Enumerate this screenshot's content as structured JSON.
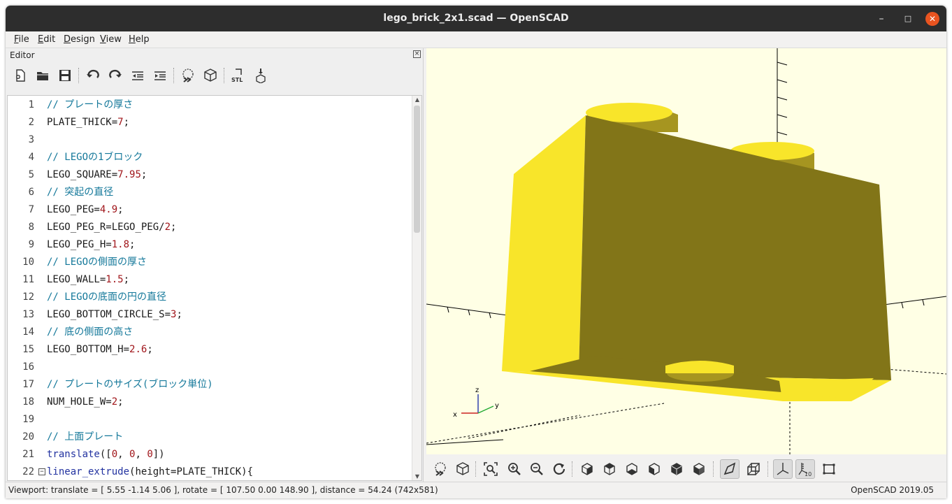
{
  "window": {
    "title": "lego_brick_2x1.scad — OpenSCAD",
    "controls": {
      "minimize": "–",
      "maximize": "□",
      "close": "✕"
    }
  },
  "menubar": [
    {
      "key": "F",
      "rest": "ile"
    },
    {
      "key": "E",
      "rest": "dit"
    },
    {
      "key": "D",
      "rest": "esign"
    },
    {
      "key": "V",
      "rest": "iew"
    },
    {
      "key": "H",
      "rest": "elp"
    }
  ],
  "editor": {
    "title": "Editor",
    "toolbar_icons": [
      "new-file-icon",
      "open-file-icon",
      "save-icon",
      "undo-icon",
      "redo-icon",
      "unindent-icon",
      "indent-icon",
      "preview-icon",
      "render-icon",
      "export-stl-icon",
      "send-to-3d-print-icon"
    ],
    "lines": [
      {
        "n": "1",
        "t": [
          {
            "c": "comment",
            "s": "// プレートの厚さ"
          }
        ]
      },
      {
        "n": "2",
        "t": [
          {
            "c": "ident",
            "s": "PLATE_THICK="
          },
          {
            "c": "num",
            "s": "7"
          },
          {
            "c": "ident",
            "s": ";"
          }
        ]
      },
      {
        "n": "3",
        "t": []
      },
      {
        "n": "4",
        "t": [
          {
            "c": "comment",
            "s": "// LEGOの1ブロック"
          }
        ]
      },
      {
        "n": "5",
        "t": [
          {
            "c": "ident",
            "s": "LEGO_SQUARE="
          },
          {
            "c": "num",
            "s": "7.95"
          },
          {
            "c": "ident",
            "s": ";"
          }
        ]
      },
      {
        "n": "6",
        "t": [
          {
            "c": "comment",
            "s": "// 突起の直径"
          }
        ]
      },
      {
        "n": "7",
        "t": [
          {
            "c": "ident",
            "s": "LEGO_PEG="
          },
          {
            "c": "num",
            "s": "4.9"
          },
          {
            "c": "ident",
            "s": ";"
          }
        ]
      },
      {
        "n": "8",
        "t": [
          {
            "c": "ident",
            "s": "LEGO_PEG_R=LEGO_PEG/"
          },
          {
            "c": "num",
            "s": "2"
          },
          {
            "c": "ident",
            "s": ";"
          }
        ]
      },
      {
        "n": "9",
        "t": [
          {
            "c": "ident",
            "s": "LEGO_PEG_H="
          },
          {
            "c": "num",
            "s": "1.8"
          },
          {
            "c": "ident",
            "s": ";"
          }
        ]
      },
      {
        "n": "10",
        "t": [
          {
            "c": "comment",
            "s": "// LEGOの側面の厚さ"
          }
        ]
      },
      {
        "n": "11",
        "t": [
          {
            "c": "ident",
            "s": "LEGO_WALL="
          },
          {
            "c": "num",
            "s": "1.5"
          },
          {
            "c": "ident",
            "s": ";"
          }
        ]
      },
      {
        "n": "12",
        "t": [
          {
            "c": "comment",
            "s": "// LEGOの底面の円の直径"
          }
        ]
      },
      {
        "n": "13",
        "t": [
          {
            "c": "ident",
            "s": "LEGO_BOTTOM_CIRCLE_S="
          },
          {
            "c": "num",
            "s": "3"
          },
          {
            "c": "ident",
            "s": ";"
          }
        ]
      },
      {
        "n": "14",
        "t": [
          {
            "c": "comment",
            "s": "// 底の側面の高さ"
          }
        ]
      },
      {
        "n": "15",
        "t": [
          {
            "c": "ident",
            "s": "LEGO_BOTTOM_H="
          },
          {
            "c": "num",
            "s": "2.6"
          },
          {
            "c": "ident",
            "s": ";"
          }
        ]
      },
      {
        "n": "16",
        "t": []
      },
      {
        "n": "17",
        "t": [
          {
            "c": "comment",
            "s": "// プレートのサイズ(ブロック単位)"
          }
        ]
      },
      {
        "n": "18",
        "t": [
          {
            "c": "ident",
            "s": "NUM_HOLE_W="
          },
          {
            "c": "num",
            "s": "2"
          },
          {
            "c": "ident",
            "s": ";"
          }
        ]
      },
      {
        "n": "19",
        "t": []
      },
      {
        "n": "20",
        "t": [
          {
            "c": "comment",
            "s": "// 上面プレート"
          }
        ]
      },
      {
        "n": "21",
        "t": [
          {
            "c": "kw",
            "s": "translate"
          },
          {
            "c": "ident",
            "s": "(["
          },
          {
            "c": "num",
            "s": "0"
          },
          {
            "c": "ident",
            "s": ", "
          },
          {
            "c": "num",
            "s": "0"
          },
          {
            "c": "ident",
            "s": ", "
          },
          {
            "c": "num",
            "s": "0"
          },
          {
            "c": "ident",
            "s": "])"
          }
        ]
      },
      {
        "n": "22",
        "fold": "−",
        "t": [
          {
            "c": "kw",
            "s": "linear_extrude"
          },
          {
            "c": "ident",
            "s": "(height=PLATE_THICK){"
          }
        ]
      }
    ]
  },
  "viewport": {
    "colors": {
      "background": "#ffffe5",
      "face_light": "#f8e52a",
      "face_dark": "#827518",
      "face_mid": "#a69520"
    },
    "axis_labels": {
      "z": "z",
      "x": "x",
      "y": "y"
    },
    "toolbar_icons": [
      "preview-icon",
      "render-icon",
      "view-all-icon",
      "zoom-in-icon",
      "zoom-out-icon",
      "reset-view-icon",
      "view-right-icon",
      "view-top-icon",
      "view-bottom-icon",
      "view-left-icon",
      "view-front-icon",
      "view-back-icon",
      "perspective-icon",
      "orthogonal-icon",
      "show-axes-icon",
      "show-scale-markers-icon",
      "show-edges-icon"
    ],
    "scale_label": "10"
  },
  "statusbar": {
    "viewport": "Viewport: translate = [ 5.55 -1.14 5.06 ], rotate = [ 107.50 0.00 148.90 ], distance = 54.24 (742x581)",
    "version": "OpenSCAD 2019.05"
  }
}
